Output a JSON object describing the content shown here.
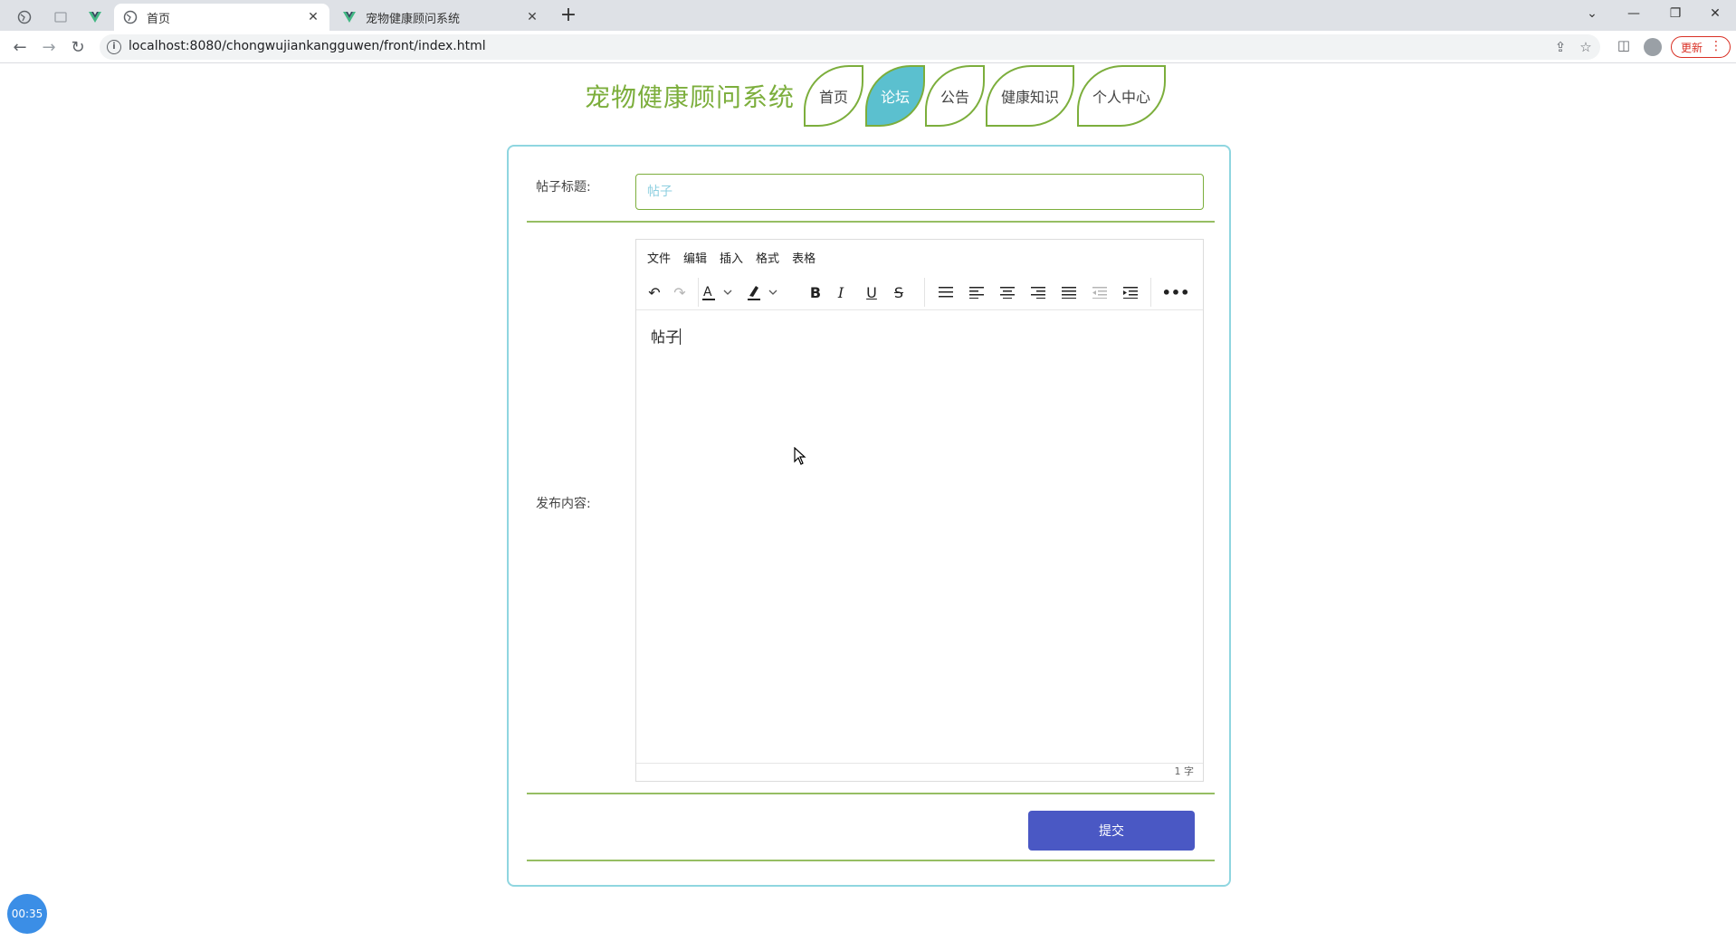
{
  "browser": {
    "tabs": [
      {
        "title": "首页",
        "active": true
      },
      {
        "title": "宠物健康顾问系统",
        "active": false
      }
    ],
    "url": "localhost:8080/chongwujiankangguwen/front/index.html",
    "update_label": "更新"
  },
  "site": {
    "title": "宠物健康顾问系统",
    "nav": [
      {
        "label": "首页",
        "active": false
      },
      {
        "label": "论坛",
        "active": true
      },
      {
        "label": "公告",
        "active": false
      },
      {
        "label": "健康知识",
        "active": false
      },
      {
        "label": "个人中心",
        "active": false
      }
    ]
  },
  "form": {
    "title_label": "帖子标题:",
    "title_placeholder": "帖子",
    "content_label": "发布内容:",
    "submit_label": "提交"
  },
  "editor": {
    "menus": [
      "文件",
      "编辑",
      "插入",
      "格式",
      "表格"
    ],
    "content": "帖子",
    "word_count": "1 字"
  },
  "timer": "00:35",
  "colors": {
    "accent_green": "#7cae3c",
    "active_tab": "#5bc0cf",
    "submit": "#4a58c4",
    "panel_border": "#8fd6e0"
  }
}
